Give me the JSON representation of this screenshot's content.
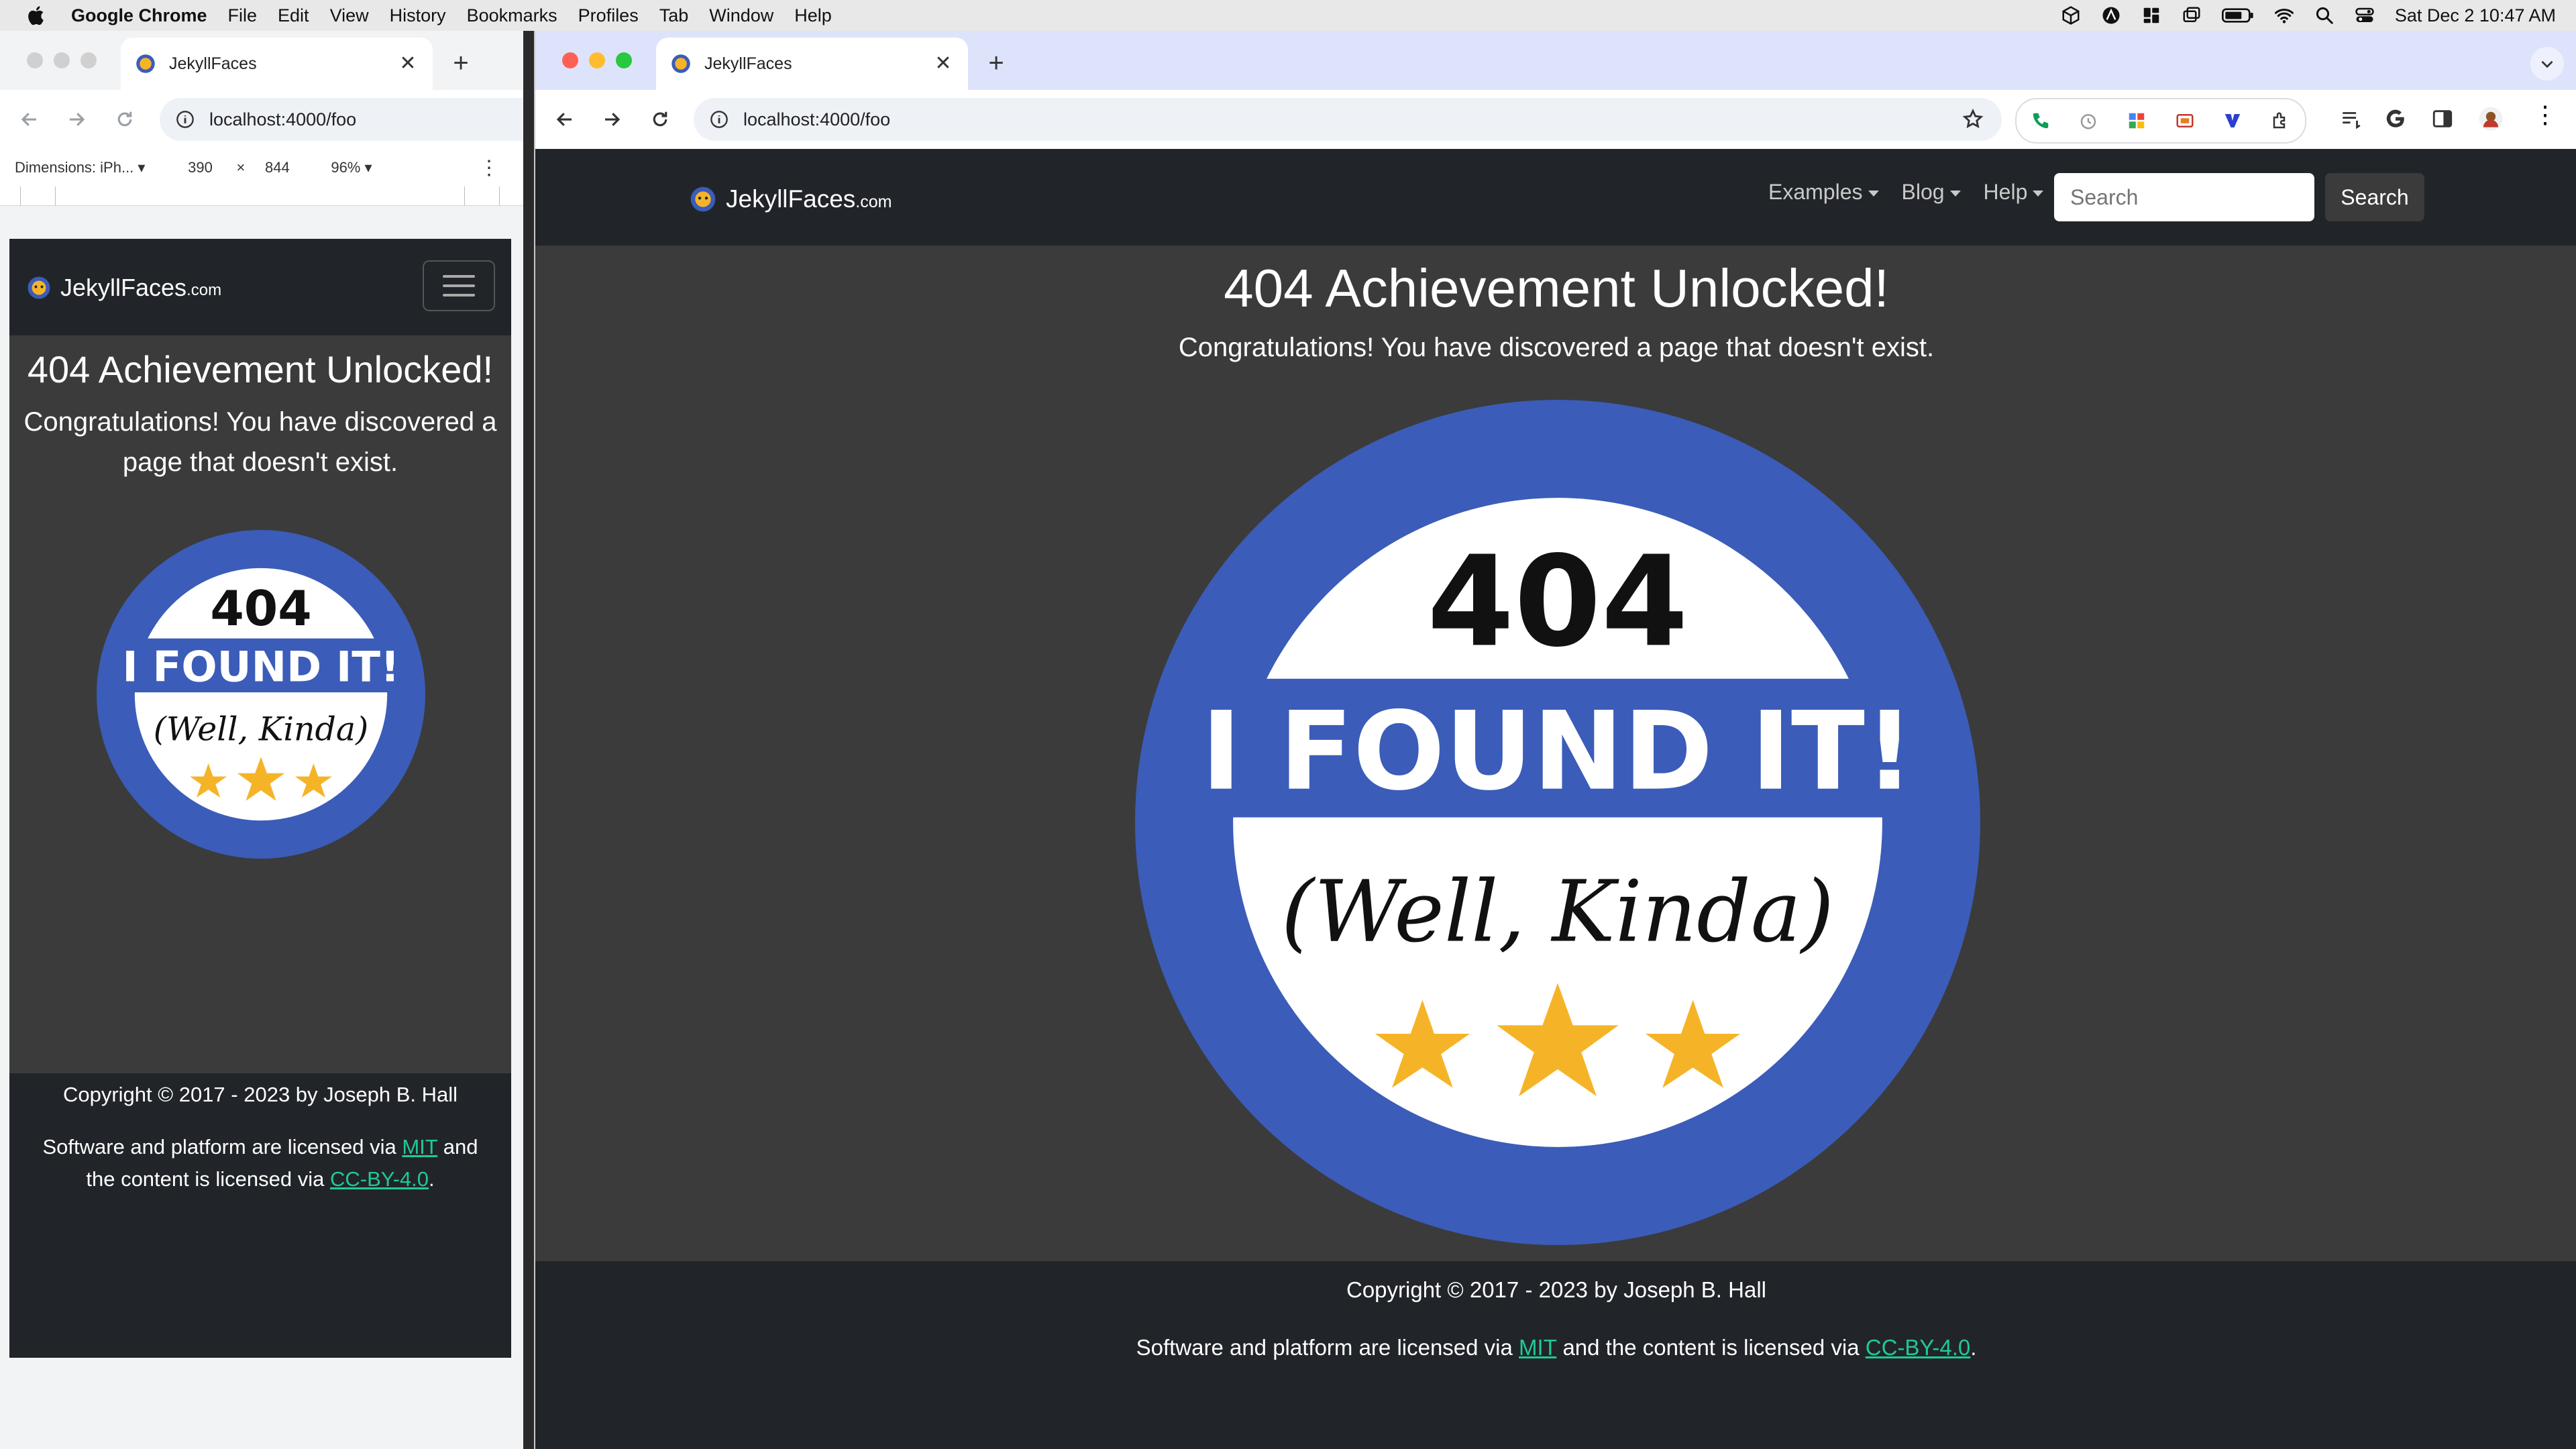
{
  "menubar": {
    "app_name": "Google Chrome",
    "items": [
      "File",
      "Edit",
      "View",
      "History",
      "Bookmarks",
      "Profiles",
      "Tab",
      "Window",
      "Help"
    ],
    "clock": "Sat Dec 2  10:47 AM"
  },
  "browser": {
    "tab_title": "JekyllFaces",
    "url": "localhost:4000/foo"
  },
  "devtools": {
    "device": "Dimensions: iPh...",
    "width": "390",
    "times": "×",
    "height": "844",
    "zoom": "96%"
  },
  "site": {
    "brand_name": "JekyllFaces",
    "brand_tld": ".com",
    "nav": {
      "examples": "Examples",
      "blog": "Blog",
      "help": "Help",
      "search_placeholder": "Search",
      "search_button": "Search"
    },
    "heading": "404 Achievement Unlocked!",
    "subheading": "Congratulations! You have discovered a page that doesn't exist.",
    "badge": {
      "number": "404",
      "headline": "I FOUND IT!",
      "sub": "(Well, Kinda)"
    },
    "footer": {
      "copyright": "Copyright © 2017 - 2023 by Joseph B. Hall",
      "license_pre": "Software and platform are licensed via ",
      "mit": "MIT",
      "license_mid": " and the content is licensed via ",
      "cc": "CC-BY-4.0",
      "license_end": "."
    }
  },
  "colors": {
    "badge_blue": "#3b5cb8",
    "star_yellow": "#f5b428",
    "link_green": "#20c997",
    "nav_dark": "#212529",
    "content_gray": "#3b3b3b"
  }
}
